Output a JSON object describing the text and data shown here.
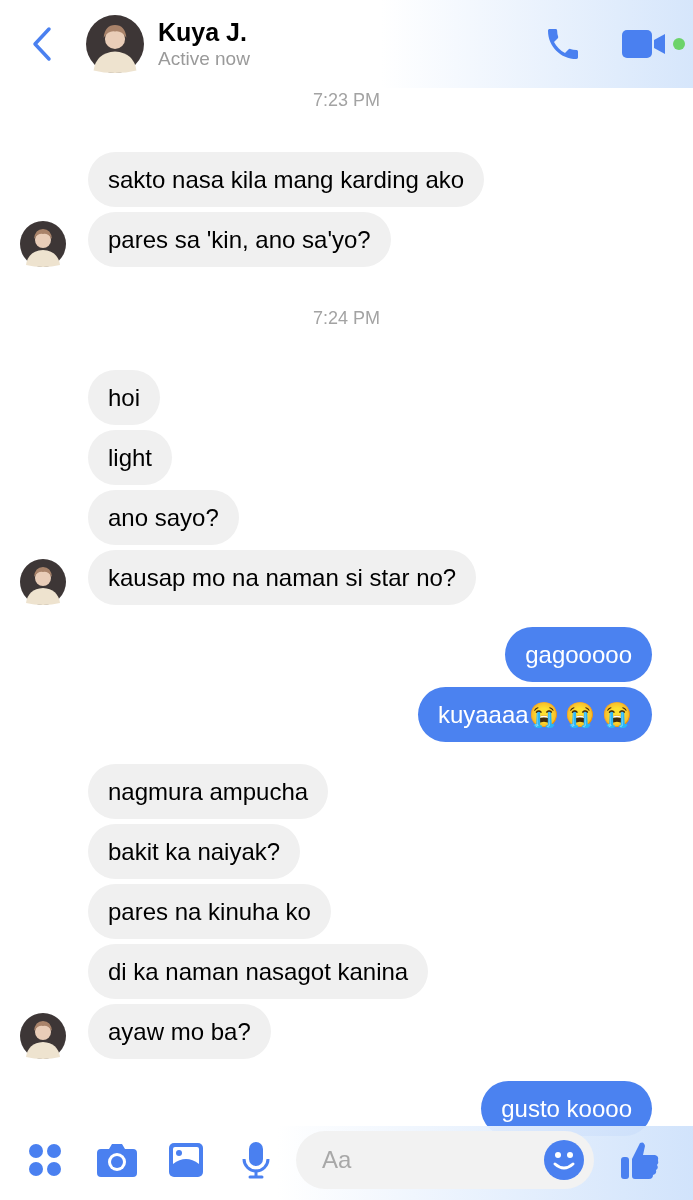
{
  "header": {
    "contact_name": "Kuya J.",
    "status": "Active now",
    "online": true
  },
  "messages": [
    {
      "kind": "timestamp",
      "text": "7:23 PM"
    },
    {
      "kind": "incoming",
      "text": "sakto nasa kila mang karding ako",
      "avatar": false
    },
    {
      "kind": "incoming",
      "text": "pares sa 'kin, ano sa'yo?",
      "avatar": true
    },
    {
      "kind": "timestamp",
      "text": "7:24 PM"
    },
    {
      "kind": "incoming",
      "text": "hoi",
      "avatar": false
    },
    {
      "kind": "incoming",
      "text": "light",
      "avatar": false
    },
    {
      "kind": "incoming",
      "text": "ano sayo?",
      "avatar": false
    },
    {
      "kind": "incoming",
      "text": "kausap mo na naman si star no?",
      "avatar": true
    },
    {
      "kind": "outgoing",
      "text": "gagooooo"
    },
    {
      "kind": "outgoing",
      "text": "kuyaaaa😭 😭 😭"
    },
    {
      "kind": "incoming",
      "text": "nagmura ampucha",
      "avatar": false
    },
    {
      "kind": "incoming",
      "text": "bakit ka naiyak?",
      "avatar": false
    },
    {
      "kind": "incoming",
      "text": "pares na kinuha ko",
      "avatar": false
    },
    {
      "kind": "incoming",
      "text": "di ka naman nasagot kanina",
      "avatar": false
    },
    {
      "kind": "incoming",
      "text": "ayaw mo ba?",
      "avatar": true
    },
    {
      "kind": "outgoing",
      "text": "gusto koooo"
    }
  ],
  "composer": {
    "placeholder": "Aa"
  }
}
